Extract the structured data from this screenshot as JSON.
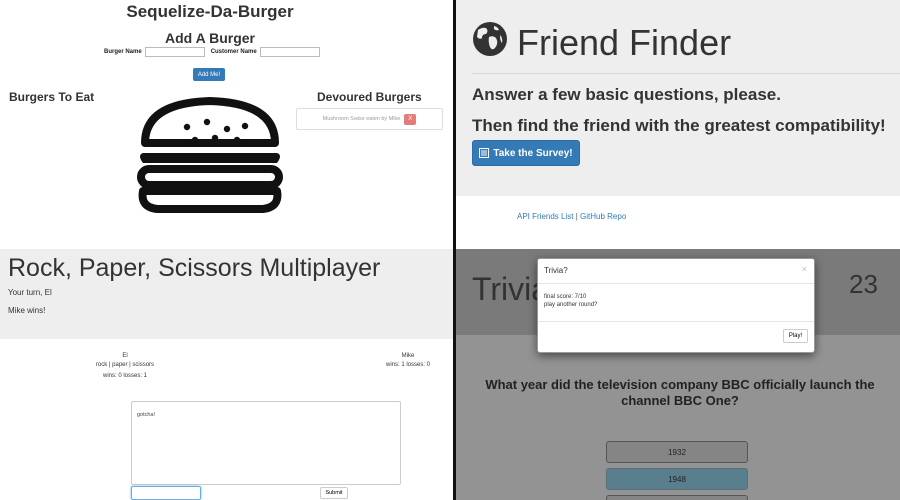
{
  "burger_app": {
    "title": "Sequelize-Da-Burger",
    "subtitle": "Add A Burger",
    "burger_name_label": "Burger Name",
    "customer_name_label": "Customer Name",
    "add_button": "Add Me!",
    "to_eat_heading": "Burgers To Eat",
    "devoured_heading": "Devoured Burgers",
    "devoured_items": [
      {
        "text": "Mushroom Swiss eaten by Mike",
        "delete_label": "X"
      }
    ]
  },
  "friend_finder": {
    "title": "Friend Finder",
    "line1": "Answer a few basic questions, please.",
    "line2": "Then find the friend with the greatest compatibility!",
    "survey_button": "Take the Survey!",
    "link_api": "API Friends List",
    "link_sep": "|",
    "link_repo": "GitHub Repo"
  },
  "rps": {
    "title": "Rock, Paper, Scissors Multiplayer",
    "turn_text": "Your turn, El",
    "result_text": "Mike wins!",
    "player1": {
      "name": "El",
      "choices": "rock | paper | scissors",
      "stats": "wins: 0 losses: 1"
    },
    "player2": {
      "name": "Mike",
      "stats": "wins: 1 losses: 0"
    },
    "chat_messages": [
      "gotcha!"
    ],
    "submit_label": "Submit"
  },
  "trivia": {
    "title": "Trivia",
    "timer": "23",
    "question": "What year did the television company BBC officially launch the channel BBC One?",
    "answers": [
      {
        "label": "1932",
        "selected": false
      },
      {
        "label": "1948",
        "selected": true
      },
      {
        "label": "",
        "selected": false
      }
    ],
    "modal": {
      "title": "Trivia?",
      "close": "×",
      "score": "final score: 7/10",
      "prompt": "play another round?",
      "play_button": "Play!"
    }
  }
}
